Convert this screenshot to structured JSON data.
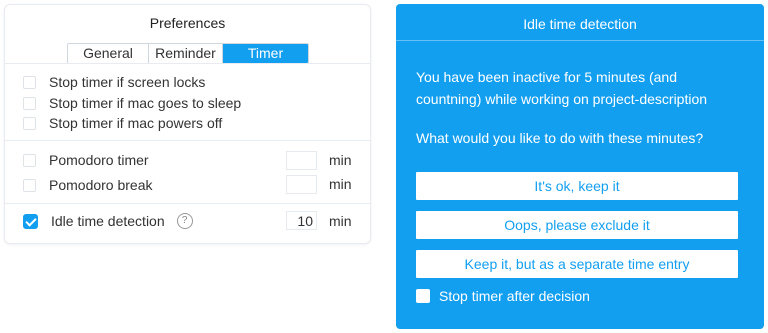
{
  "preferences": {
    "title": "Preferences",
    "tabs": [
      {
        "label": "General",
        "active": false
      },
      {
        "label": "Reminder",
        "active": false
      },
      {
        "label": "Timer",
        "active": true
      }
    ],
    "options": [
      {
        "label": "Stop timer if screen locks",
        "checked": false
      },
      {
        "label": "Stop timer if mac goes to sleep",
        "checked": false
      },
      {
        "label": "Stop timer if mac powers off",
        "checked": false
      }
    ],
    "pomodoro_timer": {
      "label": "Pomodoro timer",
      "checked": false,
      "value": "",
      "unit": "min"
    },
    "pomodoro_break": {
      "label": "Pomodoro break",
      "checked": false,
      "value": "",
      "unit": "min"
    },
    "idle_detection": {
      "label": "Idle time detection",
      "checked": true,
      "value": "10",
      "unit": "min",
      "help_icon": "?"
    }
  },
  "idle_dialog": {
    "title": "Idle time detection",
    "message": "You have been inactive for 5 minutes (and countning) while working on project-description",
    "question": "What would you like to do with these minutes?",
    "buttons": {
      "keep": "It's ok, keep it",
      "exclude": "Oops, please exclude it",
      "separate": "Keep it, but as a separate time entry"
    },
    "stop_timer_label": "Stop timer after decision",
    "stop_timer_checked": false
  },
  "colors": {
    "accent": "#139ff0",
    "text": "#333333",
    "border": "#e8ebef"
  }
}
